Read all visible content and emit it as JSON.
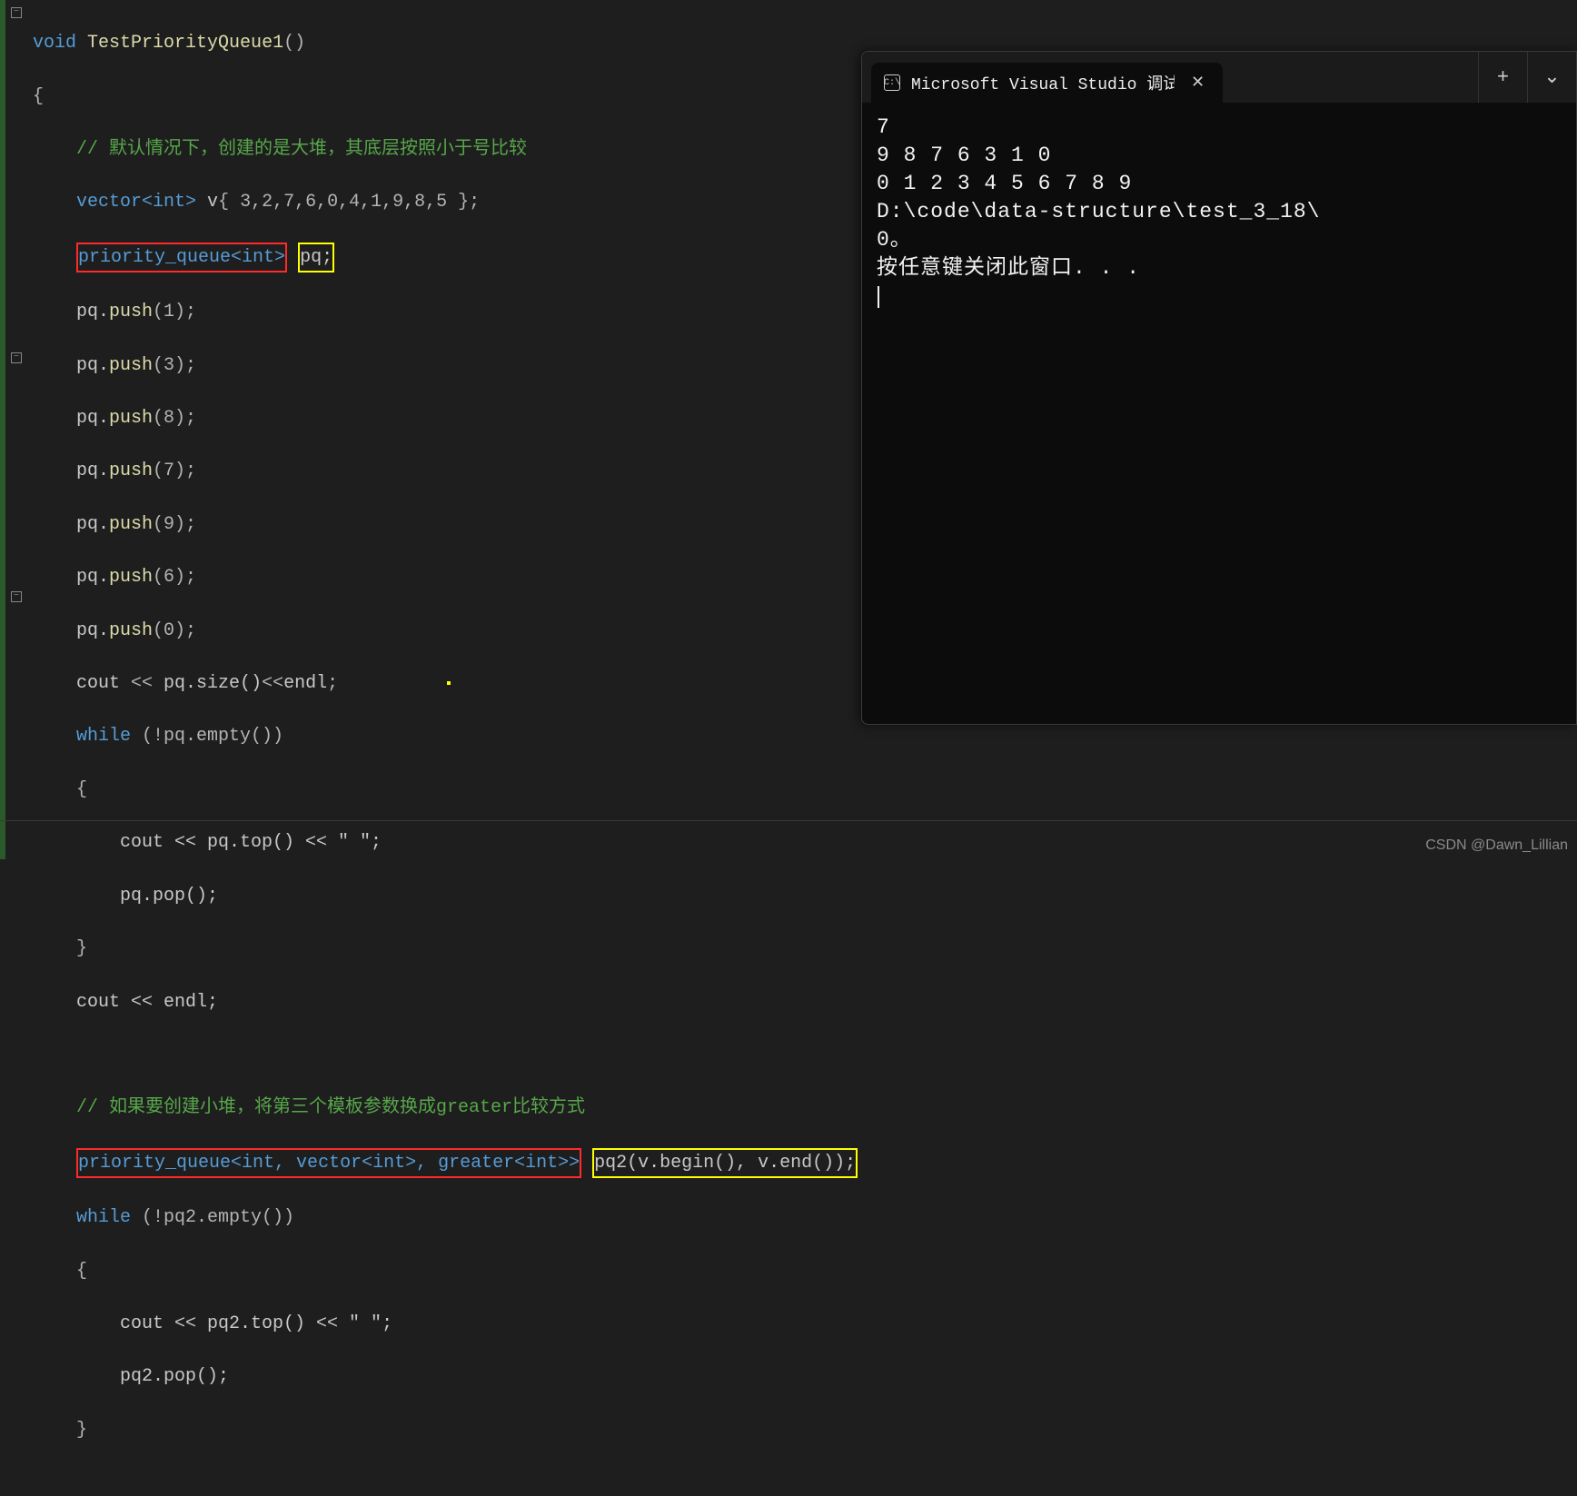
{
  "code": {
    "fn_kw": "void",
    "fn_name": "TestPriorityQueue1",
    "fn_parens": "()",
    "brace_open": "{",
    "brace_close": "}",
    "comment1": "// 默认情况下，创建的是大堆，其底层按照小于号比较",
    "vector_type": "vector",
    "vector_tpl": "<int>",
    "vector_var": " v",
    "vector_init": "{ 3,2,7,6,0,4,1,9,8,5 };",
    "pq_type": "priority_queue",
    "pq_tpl": "<int>",
    "pq_var": "pq;",
    "push_prefix": "pq.",
    "push_fn": "push",
    "push1": "(1);",
    "push3": "(3);",
    "push8": "(8);",
    "push7": "(7);",
    "push9": "(9);",
    "push6": "(6);",
    "push0": "(0);",
    "cout": "cout",
    "insert_op": " << ",
    "size_call": "pq.size()",
    "endl": "endl",
    "semi": ";",
    "while_kw": "while",
    "while_cond1": " (!pq.empty())",
    "inner_brace_open": "{",
    "inner_brace_close": "}",
    "top_line": "cout << pq.top() << \" \";",
    "pop_line": "pq.pop();",
    "cout_endl": "cout << endl;",
    "comment2": "// 如果要创建小堆，将第三个模板参数换成greater比较方式",
    "pq2_type": "priority_queue",
    "pq2_tpl": "<int, vector<int>, greater<int>>",
    "pq2_ctor": "pq2(v.begin(), v.end());",
    "while_cond2": " (!pq2.empty())",
    "top_line2": "cout << pq2.top() << \" \";",
    "pop_line2": "pq2.pop();"
  },
  "console": {
    "tab_title": "Microsoft Visual Studio 调试控",
    "tab_icon_text": "C:\\",
    "lines": {
      "l1": "7",
      "l2": "9 8 7 6 3 1 0",
      "l3": "0 1 2 3 4 5 6 7 8 9",
      "l4": "D:\\code\\data-structure\\test_3_18\\",
      "l5": "0。",
      "l6": "按任意键关闭此窗口. . ."
    },
    "plus": "+",
    "chev": "⌄"
  },
  "watermark": "CSDN @Dawn_Lillian"
}
